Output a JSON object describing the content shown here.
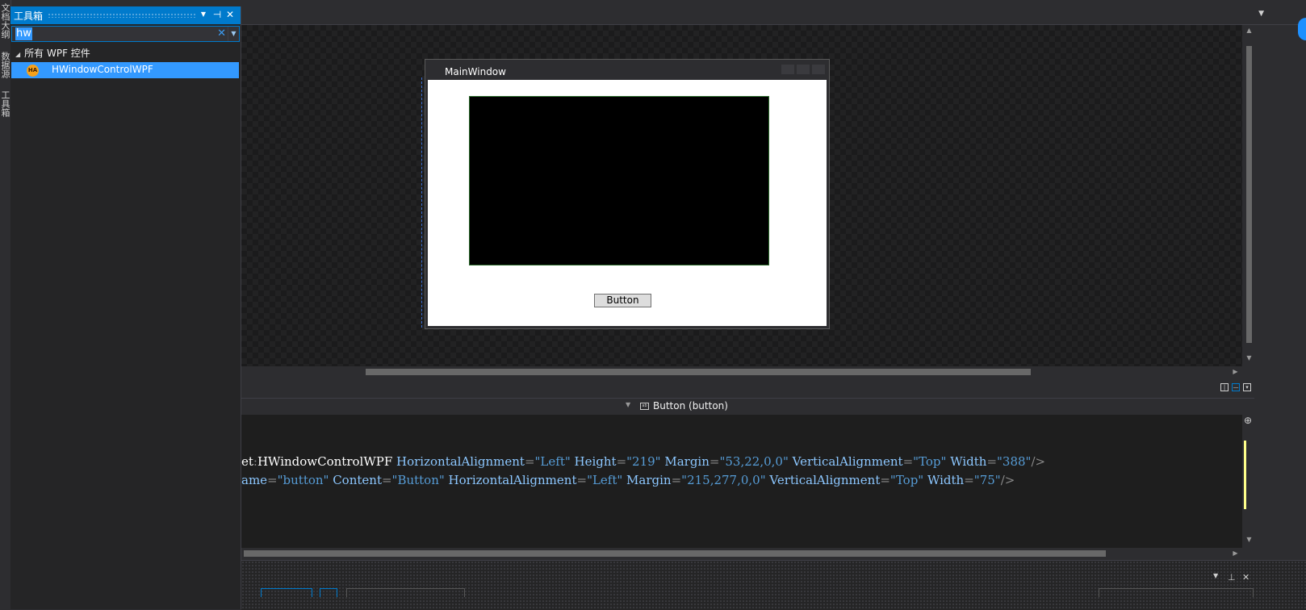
{
  "side_tabs": [
    "文档大纲",
    "数据源",
    "工具箱"
  ],
  "toolbox": {
    "title": "工具箱",
    "search_value": "hw",
    "clear_glyph": "✕",
    "group_label": "所有 WPF 控件",
    "items": [
      {
        "label": "HWindowControlWPF",
        "icon_text": "HA",
        "selected": true
      }
    ]
  },
  "design": {
    "window_title": "MainWindow",
    "button_label": "Button"
  },
  "xaml_nav": {
    "element_label": "Button (button)"
  },
  "code": {
    "line1": [
      {
        "t": "et",
        "c": "tag"
      },
      {
        "t": ":",
        "c": "pun"
      },
      {
        "t": "HWindowControlWPF",
        "c": "tag"
      },
      {
        "t": " HorizontalAlignment",
        "c": "attr"
      },
      {
        "t": "=",
        "c": "pun"
      },
      {
        "t": "\"Left\"",
        "c": "val"
      },
      {
        "t": " Height",
        "c": "attr"
      },
      {
        "t": "=",
        "c": "pun"
      },
      {
        "t": "\"219\"",
        "c": "val"
      },
      {
        "t": " Margin",
        "c": "attr"
      },
      {
        "t": "=",
        "c": "pun"
      },
      {
        "t": "\"53,22,0,0\"",
        "c": "val"
      },
      {
        "t": " VerticalAlignment",
        "c": "attr"
      },
      {
        "t": "=",
        "c": "pun"
      },
      {
        "t": "\"Top\"",
        "c": "val"
      },
      {
        "t": " Width",
        "c": "attr"
      },
      {
        "t": "=",
        "c": "pun"
      },
      {
        "t": "\"388\"",
        "c": "val"
      },
      {
        "t": "/>",
        "c": "pun"
      }
    ],
    "line2": [
      {
        "t": "ame",
        "c": "attr"
      },
      {
        "t": "=",
        "c": "pun"
      },
      {
        "t": "\"button\"",
        "c": "val"
      },
      {
        "t": " Content",
        "c": "attr"
      },
      {
        "t": "=",
        "c": "pun"
      },
      {
        "t": "\"Button\"",
        "c": "val"
      },
      {
        "t": " HorizontalAlignment",
        "c": "attr"
      },
      {
        "t": "=",
        "c": "pun"
      },
      {
        "t": "\"Left\"",
        "c": "val"
      },
      {
        "t": " Margin",
        "c": "attr"
      },
      {
        "t": "=",
        "c": "pun"
      },
      {
        "t": "\"215,277,0,0\"",
        "c": "val"
      },
      {
        "t": " VerticalAlignment",
        "c": "attr"
      },
      {
        "t": "=",
        "c": "pun"
      },
      {
        "t": "\"Top\"",
        "c": "val"
      },
      {
        "t": " Width",
        "c": "attr"
      },
      {
        "t": "=",
        "c": "pun"
      },
      {
        "t": "\"75\"",
        "c": "val"
      },
      {
        "t": "/>",
        "c": "pun"
      }
    ]
  },
  "icons": {
    "dropdown": "▼",
    "pin": "⊕",
    "close": "✕",
    "collapse_arrow": "◢"
  },
  "colors": {
    "accent": "#007acc",
    "selection": "#3399ff",
    "background": "#2d2d30",
    "editor": "#1e1e1e"
  }
}
